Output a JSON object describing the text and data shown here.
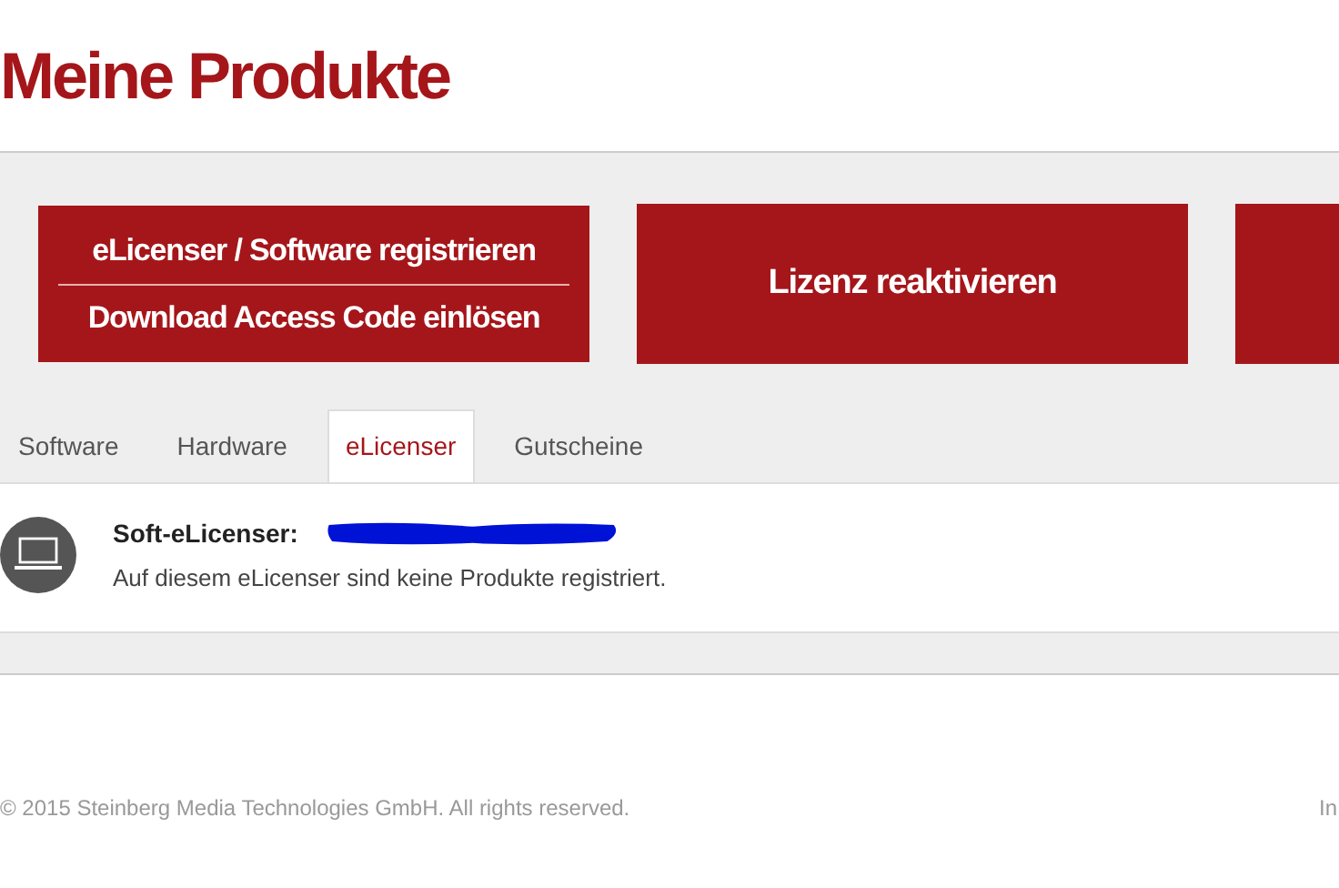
{
  "page_title": "Meine Produkte",
  "action_buttons": [
    {
      "kind": "split",
      "lines": [
        "eLicenser / Software registrieren",
        "Download Access Code einlösen"
      ]
    },
    {
      "kind": "single",
      "lines": [
        "Lizenz reaktivieren"
      ]
    },
    {
      "kind": "single"
    }
  ],
  "tabs": [
    {
      "label": "Software",
      "selected": false
    },
    {
      "label": "Hardware",
      "selected": false
    },
    {
      "label": "eLicenser",
      "selected": true
    },
    {
      "label": "Gutscheine",
      "selected": false
    }
  ],
  "licenser": {
    "label": "Soft-eLicenser:",
    "redacted": true,
    "message": "Auf diesem eLicenser sind keine Produkte registriert."
  },
  "footer": {
    "copyright": "© 2015 Steinberg Media Technologies GmbH. All rights reserved.",
    "link": "In"
  }
}
